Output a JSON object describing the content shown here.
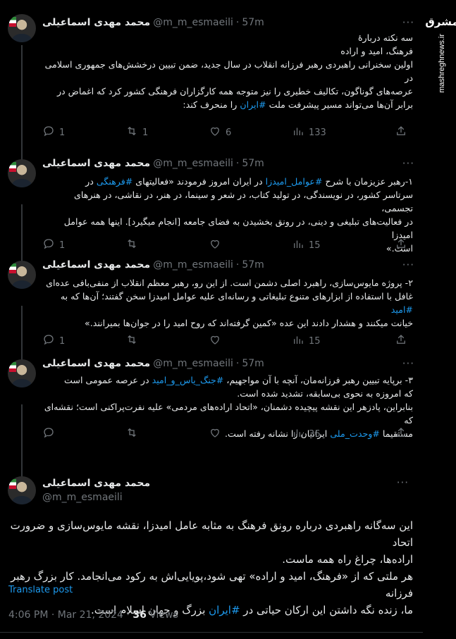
{
  "watermark": {
    "logo": "مشرق",
    "url": "mashreghnews.ir"
  },
  "author": {
    "name": "محمد مهدی اسماعیلی",
    "handle": "@m_m_esmaeili",
    "separator": "·"
  },
  "tweets": [
    {
      "time": "57m",
      "lines": [
        {
          "parts": [
            {
              "t": "سه نکته دربارۀ"
            }
          ]
        },
        {
          "parts": [
            {
              "t": "فرهنگ، امید و اراده"
            }
          ]
        },
        {
          "parts": [
            {
              "t": " "
            }
          ]
        },
        {
          "parts": [
            {
              "t": "اولین سخنرانی راهبردی رهبر فرزانه انقلاب در سال جدید، ضمن تبیین درخشش‌های جمهوری اسلامی در"
            }
          ]
        },
        {
          "parts": [
            {
              "t": "عرصه‌های گوناگون، تکالیف خطیری را نیز متوجه همه کارگزاران فرهنگی کشور کرد که اغماض در"
            }
          ]
        },
        {
          "parts": [
            {
              "t": "برابر آن‌ها می‌تواند مسیر پیشرفت ملت "
            },
            {
              "t": "#ایران",
              "tag": true
            },
            {
              "t": " را منحرف کند:"
            }
          ]
        }
      ],
      "replies": "1",
      "reposts": "1",
      "likes": "6",
      "views": "133"
    },
    {
      "time": "57m",
      "lines": [
        {
          "parts": [
            {
              "t": "۱-رهبر عزیزمان با شرح "
            },
            {
              "t": "#عوامل_امیدزا",
              "tag": true
            },
            {
              "t": " در ایران امروز فرمودند «فعالیتهای "
            },
            {
              "t": "#فرهنگی",
              "tag": true
            },
            {
              "t": " در"
            }
          ]
        },
        {
          "parts": [
            {
              "t": "سرتاسر کشور، در نویسندگی، در تولید کتاب، در شعر و سینما، در هنر، در نقاشی، در هنرهای تجسمی،"
            }
          ]
        },
        {
          "parts": [
            {
              "t": "در فعالیت‌های تبلیغی و دینی، در رونق بخشیدن به فضای جامعه [انجام میگیرد]. اینها همه عوامل امیدزا"
            }
          ]
        },
        {
          "parts": [
            {
              "t": "است.»"
            }
          ]
        }
      ],
      "replies": "1",
      "reposts": "",
      "likes": "",
      "views": "15"
    },
    {
      "time": "57m",
      "lines": [
        {
          "parts": [
            {
              "t": "۲- پروژه مایوس‌سازی، راهبرد اصلی دشمن است. از این رو، رهبر معظم انقلاب از منفی‌بافی عده‌ای"
            }
          ]
        },
        {
          "parts": [
            {
              "t": "غافل با استفاده از ابزارهای متنوع تبلیغاتی و رسانه‌ای علیه عوامل امیدزا سخن گفتند؛ آن‌ها که به "
            },
            {
              "t": "#امید",
              "tag": true
            }
          ]
        },
        {
          "parts": [
            {
              "t": "خیانت میکنند و هشدار دادند این عده «کمین گرفته‌اند که روح امید را در جوان‌ها بمیرانند.»"
            }
          ]
        }
      ],
      "replies": "1",
      "reposts": "",
      "likes": "",
      "views": "15"
    },
    {
      "time": "57m",
      "lines": [
        {
          "parts": [
            {
              "t": "۳- برپایه تبیین رهبر فرزانه‌مان، آنچه با آن مواجهیم، "
            },
            {
              "t": "#جنگ_یاس_و_امید",
              "tag": true
            },
            {
              "t": " در عرصه عمومی است"
            }
          ]
        },
        {
          "parts": [
            {
              "t": "که امروزه به نحوی بی‌سابقه، تشدید شده است."
            }
          ]
        },
        {
          "parts": [
            {
              "t": "بنابراین، پادزهر این نقشه پیچیده دشمنان، «اتحاد اراده‌های مردمی» علیه نفرت‌پراکنی است؛ نقشه‌ای که"
            }
          ]
        },
        {
          "parts": [
            {
              "t": "مستقیما "
            },
            {
              "t": "#وحدت_ملی",
              "tag": true
            },
            {
              "t": " ایرانیان را نشانه رفته است."
            }
          ]
        }
      ],
      "replies": "",
      "reposts": "",
      "likes": "",
      "views": "36"
    }
  ],
  "main": {
    "lines": [
      {
        "parts": [
          {
            "t": "این سه‌گانه راهبردی درباره رونق فرهنگ به مثابه عامل امیدزا، نقشه مایوس‌سازی و ضرورت اتحاد"
          }
        ]
      },
      {
        "parts": [
          {
            "t": "اراده‌ها، چراغ راه همه ماست."
          }
        ]
      },
      {
        "parts": [
          {
            "t": "هر ملتی که از «فرهنگ، امید و اراده» تهی شود،پویایی‌اش به رکود می‌انجامد. کار بزرگ رهبر فرزانه"
          }
        ]
      },
      {
        "parts": [
          {
            "t": "ما، زنده نگه داشتن این ارکان حیاتی در "
          },
          {
            "t": "#ایران",
            "tag": true
          },
          {
            "t": " بزرگ و جهان اسلام است."
          }
        ]
      }
    ],
    "translate": "Translate post",
    "timestamp": "4:06 PM · Mar 21, 2024 · ",
    "views_count": "36",
    "views_label": " Views"
  }
}
